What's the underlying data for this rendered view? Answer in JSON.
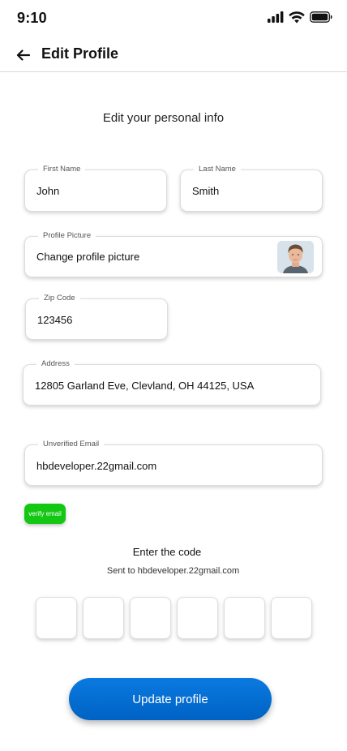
{
  "status_bar": {
    "time": "9:10"
  },
  "header": {
    "title": "Edit Profile",
    "back_icon": "arrow-left-icon"
  },
  "subtitle": "Edit your personal info",
  "form": {
    "first_name": {
      "label": "First Name",
      "value": "John"
    },
    "last_name": {
      "label": "Last Name",
      "value": "Smith"
    },
    "profile_picture": {
      "label": "Profile Picture",
      "value": "Change profile picture"
    },
    "zip_code": {
      "label": "Zip Code",
      "value": "123456"
    },
    "address": {
      "label": "Address",
      "value": "12805 Garland Eve, Clevland, OH 44125, USA"
    },
    "email": {
      "label": "Unverified Email",
      "value": "hbdeveloper.22gmail.com"
    }
  },
  "verify_button": {
    "label": "verify email",
    "color": "#13c713"
  },
  "verification": {
    "title": "Enter the code",
    "sent_to": "Sent to hbdeveloper.22gmail.com",
    "code_digits": [
      "",
      "",
      "",
      "",
      "",
      ""
    ]
  },
  "update_button": {
    "label": "Update profile",
    "color": "#0a72d6"
  }
}
